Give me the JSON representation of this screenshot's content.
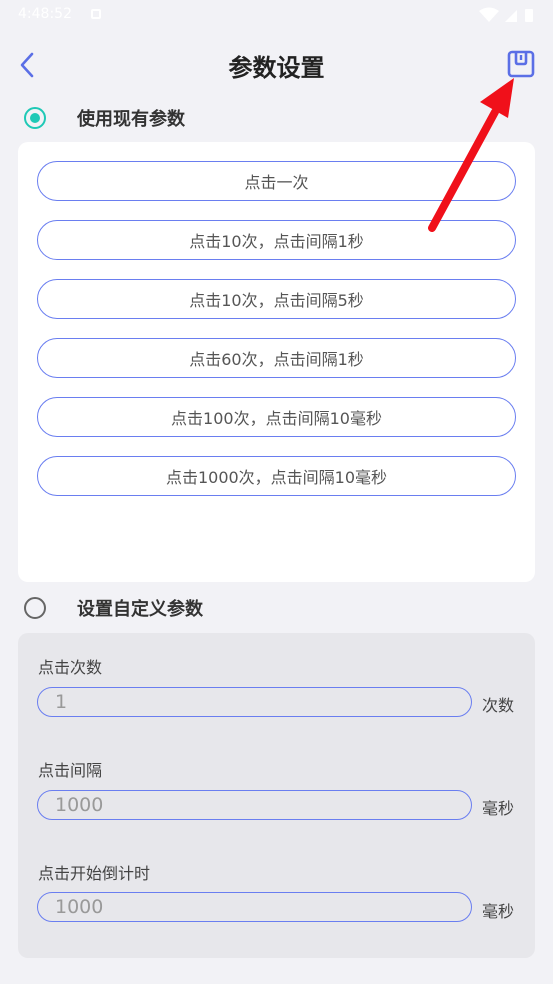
{
  "status_bar": {
    "time": "4:48:52"
  },
  "header": {
    "title": "参数设置",
    "back_icon": "chevron-left-icon",
    "save_icon": "save-icon"
  },
  "preset_section": {
    "label": "使用现有参数",
    "selected": true,
    "options": [
      "点击一次",
      "点击10次，点击间隔1秒",
      "点击10次，点击间隔5秒",
      "点击60次，点击间隔1秒",
      "点击100次，点击间隔10毫秒",
      "点击1000次，点击间隔10毫秒"
    ]
  },
  "custom_section": {
    "label": "设置自定义参数",
    "selected": false,
    "fields": [
      {
        "label": "点击次数",
        "value": "1",
        "unit": "次数"
      },
      {
        "label": "点击间隔",
        "value": "1000",
        "unit": "毫秒"
      },
      {
        "label": "点击开始倒计时",
        "value": "1000",
        "unit": "毫秒"
      }
    ]
  },
  "colors": {
    "accent": "#1fc9b6",
    "border_blue": "#6a7ef0",
    "arrow_red": "#f0101a"
  }
}
